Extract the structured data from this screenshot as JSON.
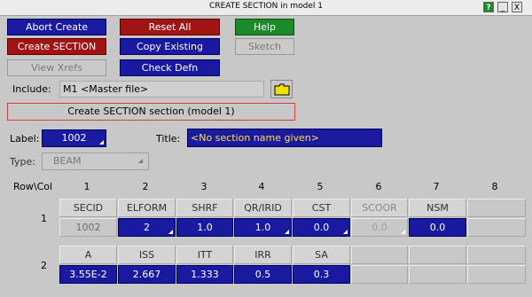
{
  "window": {
    "title": "CREATE SECTION in model 1",
    "help_btn": "?",
    "min_btn": "_",
    "close_btn": "X"
  },
  "buttons": {
    "abort_create": "Abort Create",
    "reset_all": "Reset All",
    "help": "Help",
    "create_section": "Create SECTION",
    "copy_existing": "Copy Existing",
    "sketch": "Sketch",
    "view_xrefs": "View Xrefs",
    "check_defn": "Check Defn"
  },
  "include": {
    "label": "Include:",
    "value": "M1  <Master file>"
  },
  "header_box": "Create SECTION section (model 1)",
  "label": {
    "label": "Label:",
    "value": "1002"
  },
  "title": {
    "label": "Title:",
    "value": "<No section name given>"
  },
  "type": {
    "label": "Type:",
    "value": "BEAM"
  },
  "grid": {
    "row_col_label": "Row\\Col",
    "columns": [
      "1",
      "2",
      "3",
      "4",
      "5",
      "6",
      "7",
      "8"
    ],
    "rows": [
      "1",
      "2"
    ],
    "row1_headers": [
      "SECID",
      "ELFORM",
      "SHRF",
      "QR/IRID",
      "CST",
      "SCOOR",
      "NSM",
      ""
    ],
    "row1_values": [
      "1002",
      "2",
      "1.0",
      "1.0",
      "0.0",
      "0.0",
      "0.0",
      ""
    ],
    "row2_headers": [
      "A",
      "ISS",
      "ITT",
      "IRR",
      "SA",
      "",
      "",
      ""
    ],
    "row2_values": [
      "3.55E-2",
      "2.667",
      "1.333",
      "0.5",
      "0.3",
      "",
      "",
      ""
    ]
  },
  "colors": {
    "blue": "#1a1aa0",
    "red": "#a01414",
    "green": "#1a8a2a",
    "title_text": "#ffe040"
  }
}
